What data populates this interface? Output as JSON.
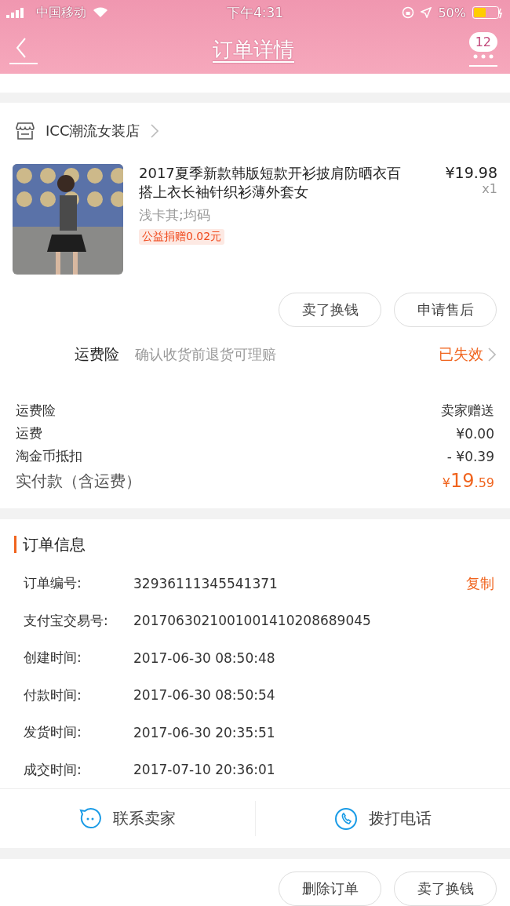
{
  "status_bar": {
    "carrier": "中国移动",
    "time": "下午4:31",
    "battery_text": "50%",
    "battery": {
      "level": 0.5
    }
  },
  "nav": {
    "title": "订单详情",
    "badge": "12"
  },
  "shop": {
    "name": "ICC潮流女装店"
  },
  "item": {
    "title": "2017夏季新款韩版短款开衫披肩防晒衣百搭上衣长袖针织衫薄外套女",
    "price": "¥19.98",
    "quantity": "x1",
    "sku": "浅卡其;均码",
    "tag": "公益捐赠0.02元"
  },
  "item_buttons": [
    "卖了换钱",
    "申请售后"
  ],
  "insurance": {
    "label": "运费险",
    "description": "确认收货前退货可理赔",
    "status": "已失效"
  },
  "summary": [
    {
      "label": "运费险",
      "value": "卖家赠送"
    },
    {
      "label": "运费",
      "value": "¥0.00"
    },
    {
      "label": "淘金币抵扣",
      "value": "- ¥0.39"
    }
  ],
  "total": {
    "label": "实付款（含运费）",
    "currency": "¥",
    "integer": "19",
    "decimal": ".59"
  },
  "order_info": {
    "title": "订单信息",
    "copy": "复制",
    "rows": [
      {
        "label": "订单编号:",
        "value": "32936111345541371"
      },
      {
        "label": "支付宝交易号:",
        "value": "2017063021001001410208689045"
      },
      {
        "label": "创建时间:",
        "value": "2017-06-30 08:50:48"
      },
      {
        "label": "付款时间:",
        "value": "2017-06-30 08:50:54"
      },
      {
        "label": "发货时间:",
        "value": "2017-06-30 20:35:51"
      },
      {
        "label": "成交时间:",
        "value": "2017-07-10 20:36:01"
      }
    ]
  },
  "contact": [
    {
      "kind": "chat",
      "label": "联系卖家"
    },
    {
      "kind": "phone",
      "label": "拨打电话"
    }
  ],
  "bottom_buttons": [
    "删除订单",
    "卖了换钱"
  ]
}
